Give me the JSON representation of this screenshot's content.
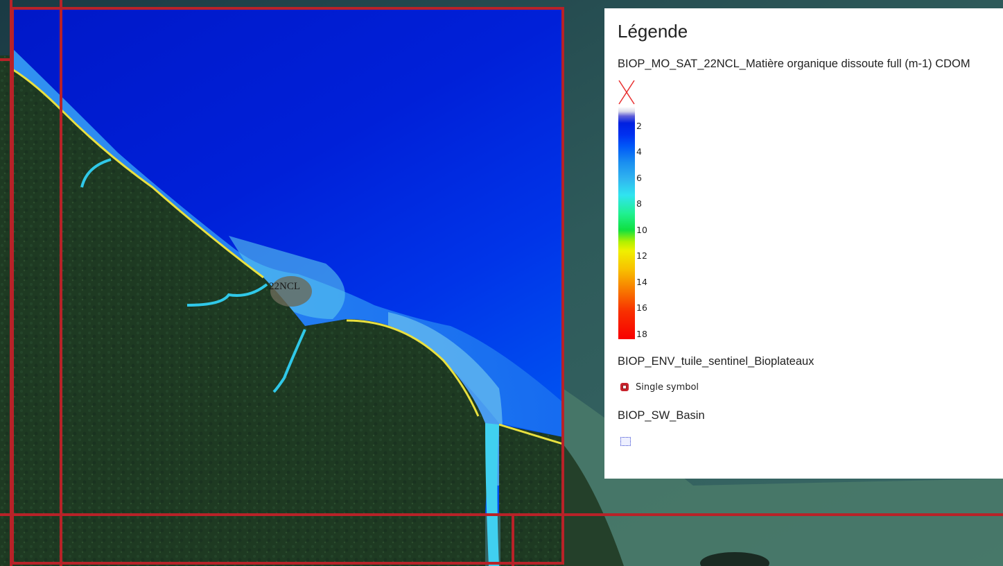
{
  "map": {
    "tile_label": "22NCL"
  },
  "legend": {
    "title": "Légende",
    "layers": [
      {
        "title": "BIOP_MO_SAT_22NCL_Matière organique dissoute full (m-1) CDOM",
        "type": "color-ramp",
        "nodata_icon": "red-x-icon",
        "ramp_labels": [
          "2",
          "4",
          "6",
          "8",
          "10",
          "12",
          "14",
          "16",
          "18"
        ],
        "ramp_colors": [
          "#0020e0",
          "#0058f8",
          "#30b4f0",
          "#30e4f0",
          "#10e040",
          "#f0f000",
          "#f89000",
          "#f86000",
          "#f80000"
        ]
      },
      {
        "title": "BIOP_ENV_tuile_sentinel_Bioplateaux",
        "type": "symbol",
        "symbol_label": "Single symbol",
        "symbol_color": "#c8232c"
      },
      {
        "title": "BIOP_SW_Basin",
        "type": "symbol",
        "symbol_color": "#3040d0"
      }
    ]
  }
}
